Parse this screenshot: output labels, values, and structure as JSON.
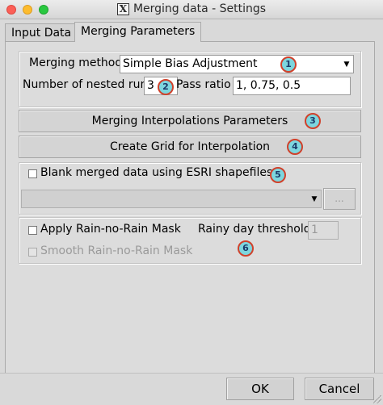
{
  "window": {
    "title": "Merging data - Settings",
    "logo_text": "X"
  },
  "tabs": [
    {
      "label": "Input Data",
      "active": false
    },
    {
      "label": "Merging Parameters",
      "active": true
    }
  ],
  "method_group": {
    "merging_method_label": "Merging method",
    "merging_method_value": "Simple Bias Adjustment",
    "nested_run_label": "Number of nested run",
    "nested_run_value": "3",
    "pass_ratio_label": "Pass ratio",
    "pass_ratio_value": "1, 0.75, 0.5"
  },
  "buttons": {
    "interp_params": "Merging Interpolations Parameters",
    "create_grid": "Create Grid for Interpolation"
  },
  "shapefile_group": {
    "blank_label": "Blank merged data using ESRI shapefiles",
    "shapefile_value": "",
    "browse_label": "..."
  },
  "mask_group": {
    "apply_mask_label": "Apply Rain-no-Rain Mask",
    "rainy_threshold_label": "Rainy day threshold",
    "rainy_threshold_value": "1",
    "smooth_mask_label": "Smooth Rain-no-Rain Mask"
  },
  "dialog": {
    "ok_label": "OK",
    "cancel_label": "Cancel"
  },
  "markers": [
    "1",
    "2",
    "3",
    "4",
    "5",
    "6"
  ],
  "colors": {
    "marker_fill": "#7dd6de",
    "marker_border": "#d0412b",
    "background": "#dcdcdc"
  }
}
